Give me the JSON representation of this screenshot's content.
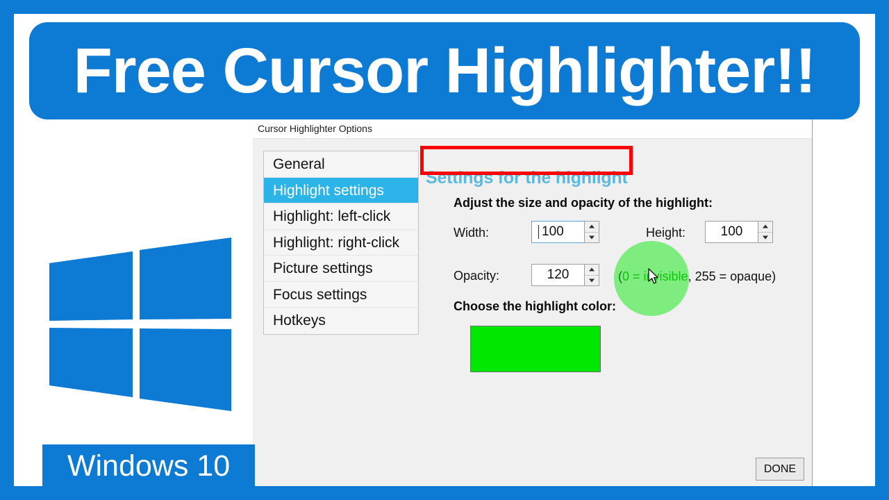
{
  "banner": {
    "headline": "Free Cursor Highlighter!!",
    "background_color": "#0d7ad4",
    "text_color": "#ffffff"
  },
  "left_panel": {
    "logo_name": "windows-logo",
    "logo_color": "#0d7ad4",
    "badge_label": "Windows 10",
    "badge_background": "#0d7ad4"
  },
  "window": {
    "title": "Cursor Highlighter Options",
    "background": "#f0f0f0"
  },
  "sidebar": {
    "items": [
      {
        "label": "General",
        "selected": false
      },
      {
        "label": "Highlight settings",
        "selected": true
      },
      {
        "label": "Highlight: left-click",
        "selected": false
      },
      {
        "label": "Highlight: right-click",
        "selected": false
      },
      {
        "label": "Picture settings",
        "selected": false
      },
      {
        "label": "Focus settings",
        "selected": false
      },
      {
        "label": "Hotkeys",
        "selected": false
      }
    ],
    "selected_color": "#2cb4e8"
  },
  "pane": {
    "title": "Settings for the highlight",
    "title_color": "#59b9e0",
    "subtitle": "Adjust the size and opacity of the highlight:",
    "fields": {
      "width_label": "Width:",
      "width_value": "100",
      "height_label": "Height:",
      "height_value": "100",
      "opacity_label": "Opacity:",
      "opacity_value": "120"
    },
    "opacity_hint_prefix": "(",
    "opacity_hint_green": "0 = invisible",
    "opacity_hint_suffix": ", 255 = opaque)",
    "color_label": "Choose the highlight color:",
    "color_swatch_value": "#00e800"
  },
  "buttons": {
    "done_label": "DONE"
  },
  "annotation": {
    "highlight_box_color": "#ff0000"
  },
  "cursor_overlay": {
    "highlight_color": "#00e800",
    "highlight_opacity": "120",
    "pointer_name": "mouse-pointer"
  }
}
